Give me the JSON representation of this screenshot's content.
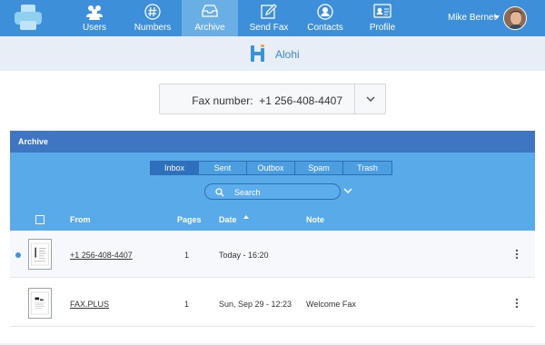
{
  "nav": {
    "items": [
      {
        "label": "Users",
        "icon": "users-icon"
      },
      {
        "label": "Numbers",
        "icon": "hash-icon"
      },
      {
        "label": "Archive",
        "icon": "inbox-tray-icon"
      },
      {
        "label": "Send Fax",
        "icon": "compose-icon"
      },
      {
        "label": "Contacts",
        "icon": "contact-icon"
      },
      {
        "label": "Profile",
        "icon": "id-card-icon"
      }
    ],
    "active": "Archive",
    "user_name": "Mike Bernet"
  },
  "brand": {
    "name": "Alohi"
  },
  "fax_selector": {
    "label": "Fax number:",
    "number": "+1 256-408-4407",
    "display": "Fax number:  +1 256-408-4407"
  },
  "archive": {
    "title": "Archive",
    "tabs": [
      "Inbox",
      "Sent",
      "Outbox",
      "Spam",
      "Trash"
    ],
    "active_tab": "Inbox",
    "search_placeholder": "Search",
    "columns": {
      "from": "From",
      "pages": "Pages",
      "date": "Date",
      "note": "Note"
    },
    "rows": [
      {
        "from": "+1 256-408-4407",
        "pages": "1",
        "date": "Today - 16:20",
        "note": "",
        "unread": true
      },
      {
        "from": "FAX.PLUS",
        "pages": "1",
        "date": "Sun, Sep 29 - 12:23",
        "note": "Welcome Fax",
        "unread": false
      }
    ]
  },
  "colors": {
    "nav": "#3e8fd9",
    "nav_active": "#6aaee6",
    "panel_header": "#3f75c2",
    "panel_body": "#58aae8",
    "brand": "#3f86c9"
  }
}
